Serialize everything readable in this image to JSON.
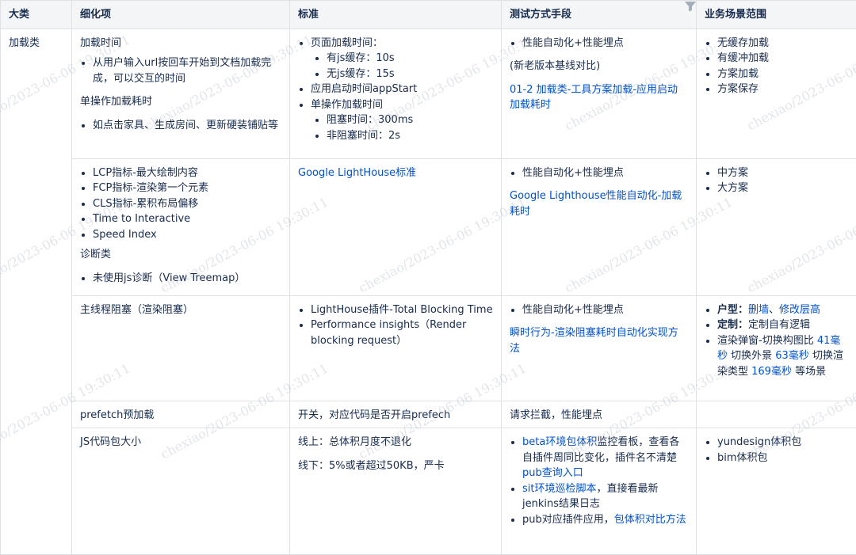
{
  "headers": [
    "大类",
    "细化项",
    "标准",
    "测试方式手段",
    "业务场景范围"
  ],
  "watermark": "chexiao/2023-06-06 19:30:11",
  "rows": {
    "r1": {
      "category": "加载类",
      "detail": {
        "heading1": "加载时间",
        "bullet1": "从用户输入url按回车开始到文档加载完成，可以交互的时间",
        "heading2": "单操作加载耗时",
        "bullet2": "如点击家具、生成房间、更新硬装铺贴等"
      },
      "standard": {
        "b1": "页面加载时间：",
        "b1a": "有js缓存：10s",
        "b1b": "无js缓存：15s",
        "b2": "应用启动时间appStart",
        "b3": "单操作加载时间",
        "b3a": "阻塞时间：300ms",
        "b3b": "非阻塞时间：2s"
      },
      "test": {
        "b1": "性能自动化+性能埋点",
        "note": "(新老版本基线对比)",
        "link": "01-2 加载类-工具方案加载-应用启动加载耗时"
      },
      "scope": [
        "无缓存加载",
        "有缓冲加载",
        "方案加载",
        "方案保存"
      ]
    },
    "r2": {
      "detail": {
        "bullets": [
          "LCP指标-最大绘制内容",
          "FCP指标-渲染第一个元素",
          "CLS指标-累积布局偏移",
          "Time to Interactive",
          "Speed Index"
        ],
        "heading": "诊断类",
        "bullet2": "未使用js诊断（View Treemap）"
      },
      "standard_link": "Google LightHouse标准",
      "test": {
        "b1": "性能自动化+性能埋点",
        "link": "Google Lighthouse性能自动化-加载耗时"
      },
      "scope": [
        "中方案",
        "大方案"
      ]
    },
    "r3": {
      "detail": "主线程阻塞（渲染阻塞）",
      "standard": [
        "LightHouse插件-Total Blocking Time",
        "Performance insights（Render blocking request）"
      ],
      "test": {
        "b1": "性能自动化+性能埋点",
        "link": "瞬时行为-渲染阻塞耗时自动化实现方法"
      },
      "scope": {
        "s1_label": "户型：",
        "s1_link1": "删墙",
        "s1_sep": "、",
        "s1_link2": "修改层高",
        "s2_label": "定制：",
        "s2_text": "定制自有逻辑",
        "s3_pre": "渲染弹窗-切换构图比 ",
        "s3_l1": "41毫秒",
        "s3_mid1": " 切换外景 ",
        "s3_l2": "63毫秒",
        "s3_mid2": " 切换渲染类型 ",
        "s3_l3": "169毫秒",
        "s3_post": " 等场景"
      }
    },
    "r4": {
      "detail": "prefetch预加载",
      "standard": "开关，对应代码是否开启prefech",
      "test": "请求拦截，性能埋点"
    },
    "r5": {
      "detail": "JS代码包大小",
      "standard1": "线上：总体积月度不退化",
      "standard2": "线下：5%或者超过50KB，严卡",
      "test": {
        "b1_link": "beta环境包体积",
        "b1_text": "监控看板，查看各自插件周同比变化，插件名不清楚",
        "b1_link2": "pub查询入口",
        "b2_link": "sit环境巡检脚本",
        "b2_text": "，直接看最新jenkins结果日志",
        "b3_text": "pub对应插件应用，",
        "b3_link": "包体积对比方法"
      },
      "scope": [
        "yundesign体积包",
        "bim体积包"
      ]
    }
  }
}
